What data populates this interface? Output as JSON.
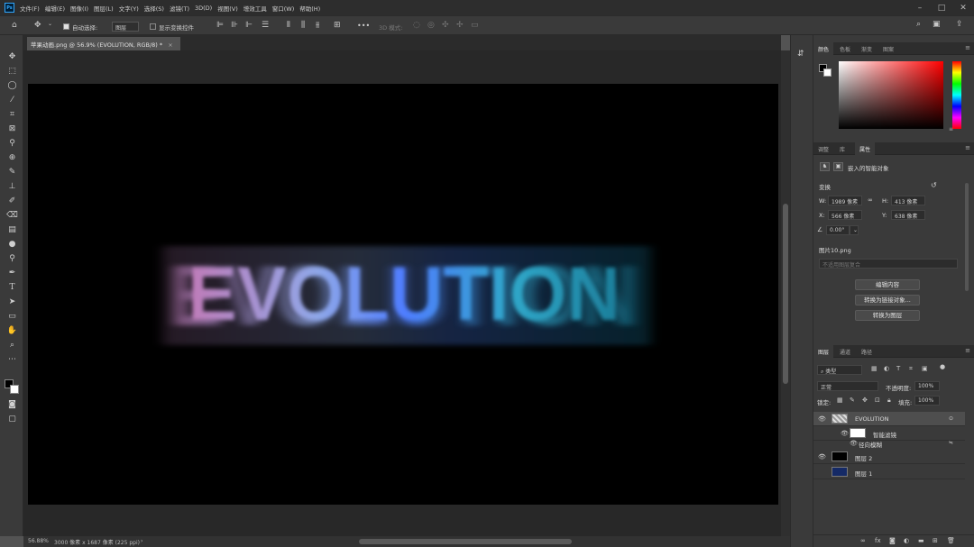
{
  "menubar": {
    "app_icon": "Ps",
    "items": [
      "文件(F)",
      "编辑(E)",
      "图像(I)",
      "图层(L)",
      "文字(Y)",
      "选择(S)",
      "滤镜(T)",
      "3D(D)",
      "视图(V)",
      "增效工具",
      "窗口(W)",
      "帮助(H)"
    ]
  },
  "options": {
    "auto_select_label": "自动选择:",
    "auto_select_value": "图层",
    "show_transform_label": "显示变换控件",
    "mode_3d_label": "3D 模式:",
    "more": "•••"
  },
  "document": {
    "tab_title": "苹果动画.png @ 56.9% (EVOLUTION, RGB/8) *",
    "canvas_text": "EVOLUTION",
    "status_zoom": "56.88%",
    "status_info": "3000 像素 x 1687 像素 (225 ppi)"
  },
  "color_panel": {
    "tabs": [
      "颜色",
      "色板",
      "渐变",
      "图案"
    ],
    "active": "颜色"
  },
  "props_panel": {
    "tabs": [
      "调整",
      "库",
      "属性"
    ],
    "active": "属性",
    "type_label": "嵌入的智能对象",
    "transform_label": "变换",
    "w_label": "W:",
    "w_value": "1989 像素",
    "h_label": "H:",
    "h_value": "413 像素",
    "x_label": "X:",
    "x_value": "566 像素",
    "y_label": "Y:",
    "y_value": "638 像素",
    "angle_value": "0.00°",
    "file_name": "图片10.png",
    "comp_placeholder": "不适用图层复合",
    "btn_edit": "编辑内容",
    "btn_convert_link": "转换为链接对象...",
    "btn_convert_layer": "转换为图层"
  },
  "layers_panel": {
    "tabs": [
      "图层",
      "通道",
      "路径"
    ],
    "active": "图层",
    "filter_kind": "类型",
    "blend_mode": "正常",
    "opacity_label": "不透明度:",
    "opacity_value": "100%",
    "lock_label": "锁定:",
    "fill_label": "填充:",
    "fill_value": "100%",
    "layers": [
      {
        "name": "EVOLUTION",
        "selected": true
      },
      {
        "name": "智能滤镜"
      },
      {
        "name": "径向模糊"
      },
      {
        "name": "图层 2"
      },
      {
        "name": "图层 1"
      }
    ]
  },
  "colors": {
    "accent": "#31a8ff",
    "panel": "#3a3a3a",
    "canvas": "#000000",
    "workspace": "#282828"
  }
}
